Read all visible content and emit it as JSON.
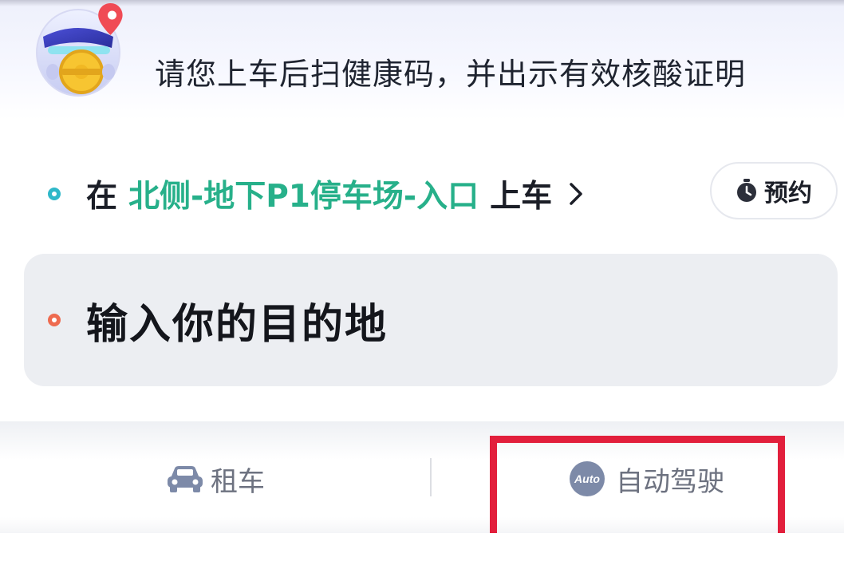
{
  "notice": {
    "text": "请您上车后扫健康码，并出示有效核酸证明"
  },
  "pickup": {
    "prefix": "在",
    "location": "北侧-地下P1停车场-入口",
    "suffix": "上车",
    "icon": "chevron-right-icon"
  },
  "reserve": {
    "label": "预约",
    "icon": "stopwatch-icon"
  },
  "destination": {
    "placeholder": "输入你的目的地"
  },
  "tabs": [
    {
      "label": "租车",
      "icon": "car-icon"
    },
    {
      "label": "自动驾驶",
      "icon": "auto-icon",
      "icon_text": "Auto"
    }
  ],
  "colors": {
    "pickup_location": "#27b08a",
    "pickup_dot": "#2fb8c9",
    "destination_dot": "#ee6b50",
    "highlight": "#e21f3c"
  }
}
